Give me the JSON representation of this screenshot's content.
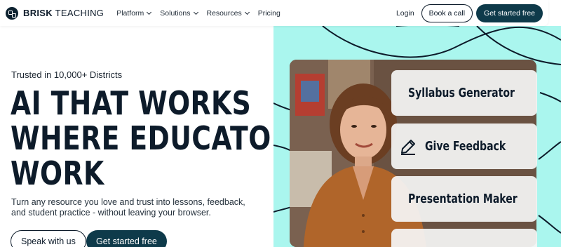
{
  "nav": {
    "brand_bold": "BRISK",
    "brand_light": " TEACHING",
    "links": [
      "Platform",
      "Solutions",
      "Resources",
      "Pricing"
    ],
    "login": "Login",
    "book_call": "Book a call",
    "get_started": "Get started free"
  },
  "hero": {
    "trusted": "Trusted in 10,000+ Districts",
    "headline": [
      "AI THAT WORKS",
      "WHERE EDUCATORS",
      "WORK"
    ],
    "subtitle": "Turn any resource you love and trust into lessons, feedback, and student practice - without leaving your browser.",
    "cta_secondary": "Speak with us",
    "cta_primary": "Get started free"
  },
  "feature_cards": [
    {
      "label": "Syllabus Generator",
      "icon": "notebook-icon"
    },
    {
      "label": "Give Feedback",
      "icon": "pen-icon"
    },
    {
      "label": "Presentation Maker",
      "icon": "presentation-icon"
    }
  ],
  "colors": {
    "accent_dark": "#0e3a4a",
    "panel_bg": "#aaf6ee",
    "text": "#0d1b2a"
  }
}
